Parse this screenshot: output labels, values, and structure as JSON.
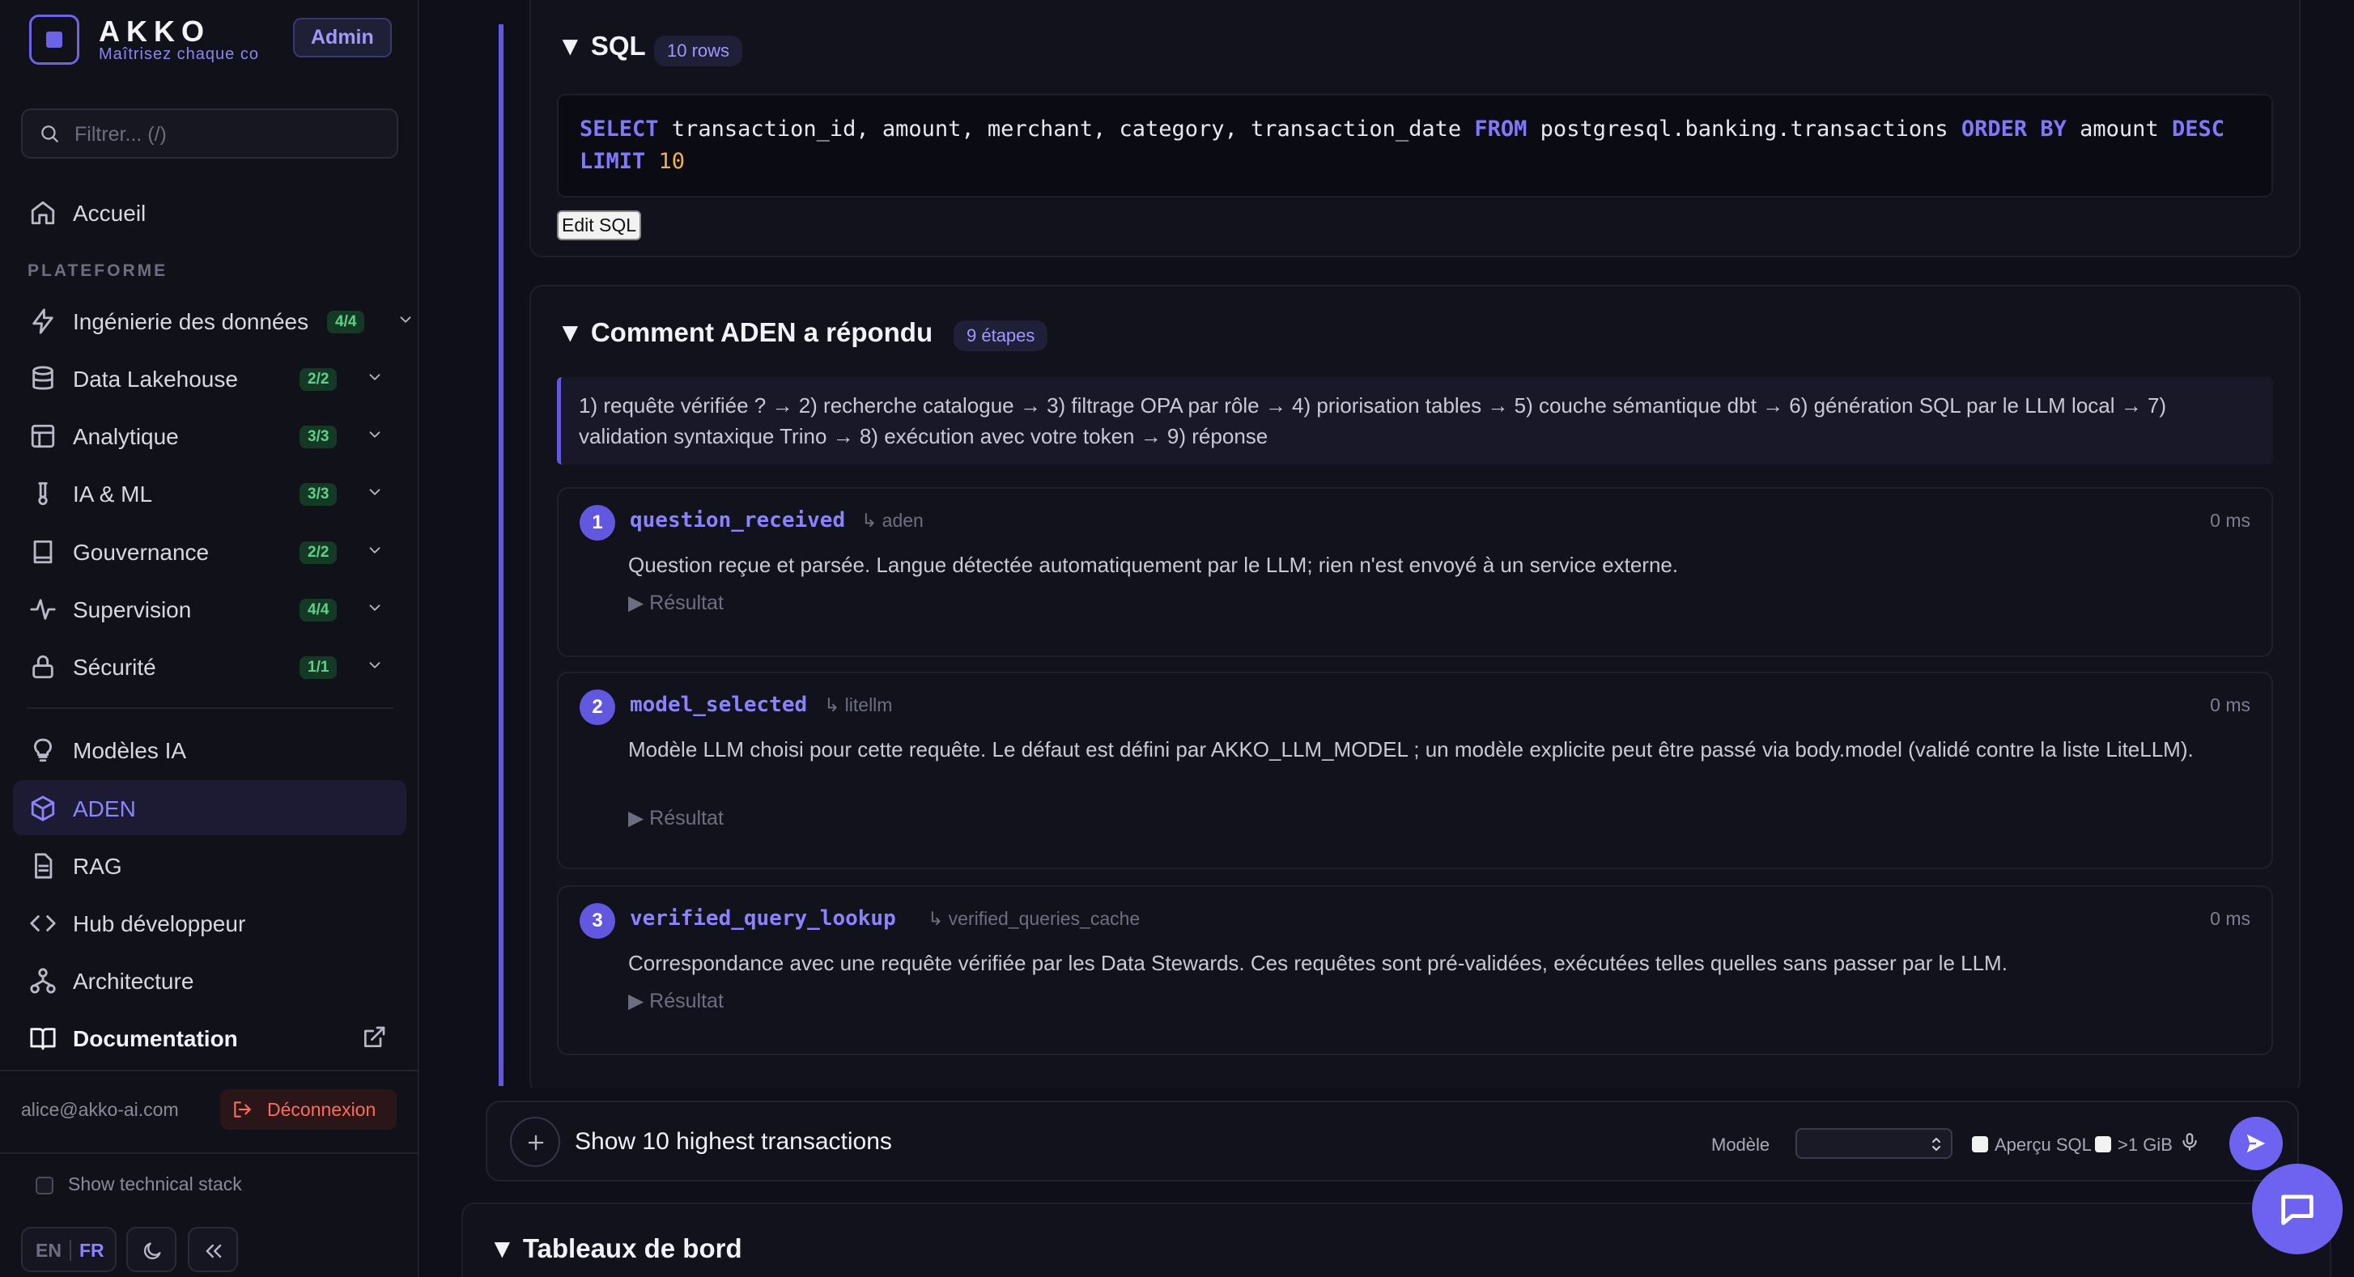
{
  "brand": {
    "name": "AKKO",
    "tagline": "Maîtrisez chaque co",
    "role_badge": "Admin"
  },
  "sidebar": {
    "filter_placeholder": "Filtrer... (/)",
    "home_label": "Accueil",
    "section_label": "PLATEFORME",
    "platform_items": [
      {
        "label": "Ingénierie des données",
        "count": "4/4"
      },
      {
        "label": "Data Lakehouse",
        "count": "2/2"
      },
      {
        "label": "Analytique",
        "count": "3/3"
      },
      {
        "label": "IA & ML",
        "count": "3/3"
      },
      {
        "label": "Gouvernance",
        "count": "2/2"
      },
      {
        "label": "Supervision",
        "count": "4/4"
      },
      {
        "label": "Sécurité",
        "count": "1/1"
      }
    ],
    "extra_items": [
      {
        "label": "Modèles IA"
      },
      {
        "label": "ADEN"
      },
      {
        "label": "RAG"
      },
      {
        "label": "Hub développeur"
      },
      {
        "label": "Architecture"
      },
      {
        "label": "Documentation"
      }
    ],
    "user_email": "alice@akko-ai.com",
    "logout_label": "Déconnexion",
    "tech_stack_label": "Show technical stack",
    "lang_en": "EN",
    "lang_fr": "FR"
  },
  "sql_card": {
    "title": "▼ SQL",
    "rows_badge": "10 rows",
    "edit_label": "Edit SQL",
    "query": {
      "kw_select": "SELECT",
      "columns": " transaction_id, amount, merchant, category, transaction_date ",
      "kw_from": "FROM",
      "table": " postgresql.banking.transactions ",
      "kw_order_by": "ORDER BY",
      "order_col": " amount ",
      "kw_desc": "DESC",
      "kw_limit": "LIMIT",
      "limit_value": "10"
    }
  },
  "reasoning_card": {
    "title": "▼ Comment ADEN a répondu",
    "steps_badge": "9 étapes",
    "summary": "1) requête vérifiée ? → 2) recherche catalogue → 3) filtrage OPA par rôle → 4) priorisation tables → 5) couche sémantique dbt → 6) génération SQL par le LLM local → 7) validation syntaxique Trino → 8) exécution avec votre token → 9) réponse",
    "result_label": "▶ Résultat",
    "steps": [
      {
        "num": "1",
        "name": "question_received",
        "agent": "↳ aden",
        "time": "0 ms",
        "description": "Question reçue et parsée. Langue détectée automatiquement par le LLM; rien n'est envoyé à un service externe."
      },
      {
        "num": "2",
        "name": "model_selected",
        "agent": "↳ litellm",
        "time": "0 ms",
        "description": "Modèle LLM choisi pour cette requête. Le défaut est défini par AKKO_LLM_MODEL ; un modèle explicite peut être passé via body.model (validé contre la liste LiteLLM)."
      },
      {
        "num": "3",
        "name": "verified_query_lookup",
        "agent": "↳ verified_queries_cache",
        "time": "0 ms",
        "description": "Correspondance avec une requête vérifiée par les Data Stewards. Ces requêtes sont pré-validées, exécutées telles quelles sans passer par le LLM."
      }
    ]
  },
  "chat": {
    "input_value": "Show 10 highest transactions",
    "model_label": "Modèle",
    "model_value": "",
    "sql_preview_label": "Aperçu SQL",
    "size_label": ">1 GiB"
  },
  "dashboards_title": "▼ Tableaux de bord",
  "colors": {
    "accent": "#6d63f0",
    "success": "#5fd08a",
    "danger": "#ff6b5b",
    "background": "#0f0f1a"
  },
  "icons": [
    "home-icon",
    "lightning-icon",
    "database-icon",
    "layout-icon",
    "flask-icon",
    "book-icon",
    "activity-icon",
    "lock-icon",
    "bulb-icon",
    "cube-icon",
    "file-icon",
    "code-icon",
    "network-icon",
    "book-open-icon",
    "external-link-icon",
    "logout-icon",
    "moon-icon",
    "double-chevron-left-icon",
    "plus-icon",
    "mic-icon",
    "send-icon",
    "chat-icon",
    "search-icon"
  ]
}
